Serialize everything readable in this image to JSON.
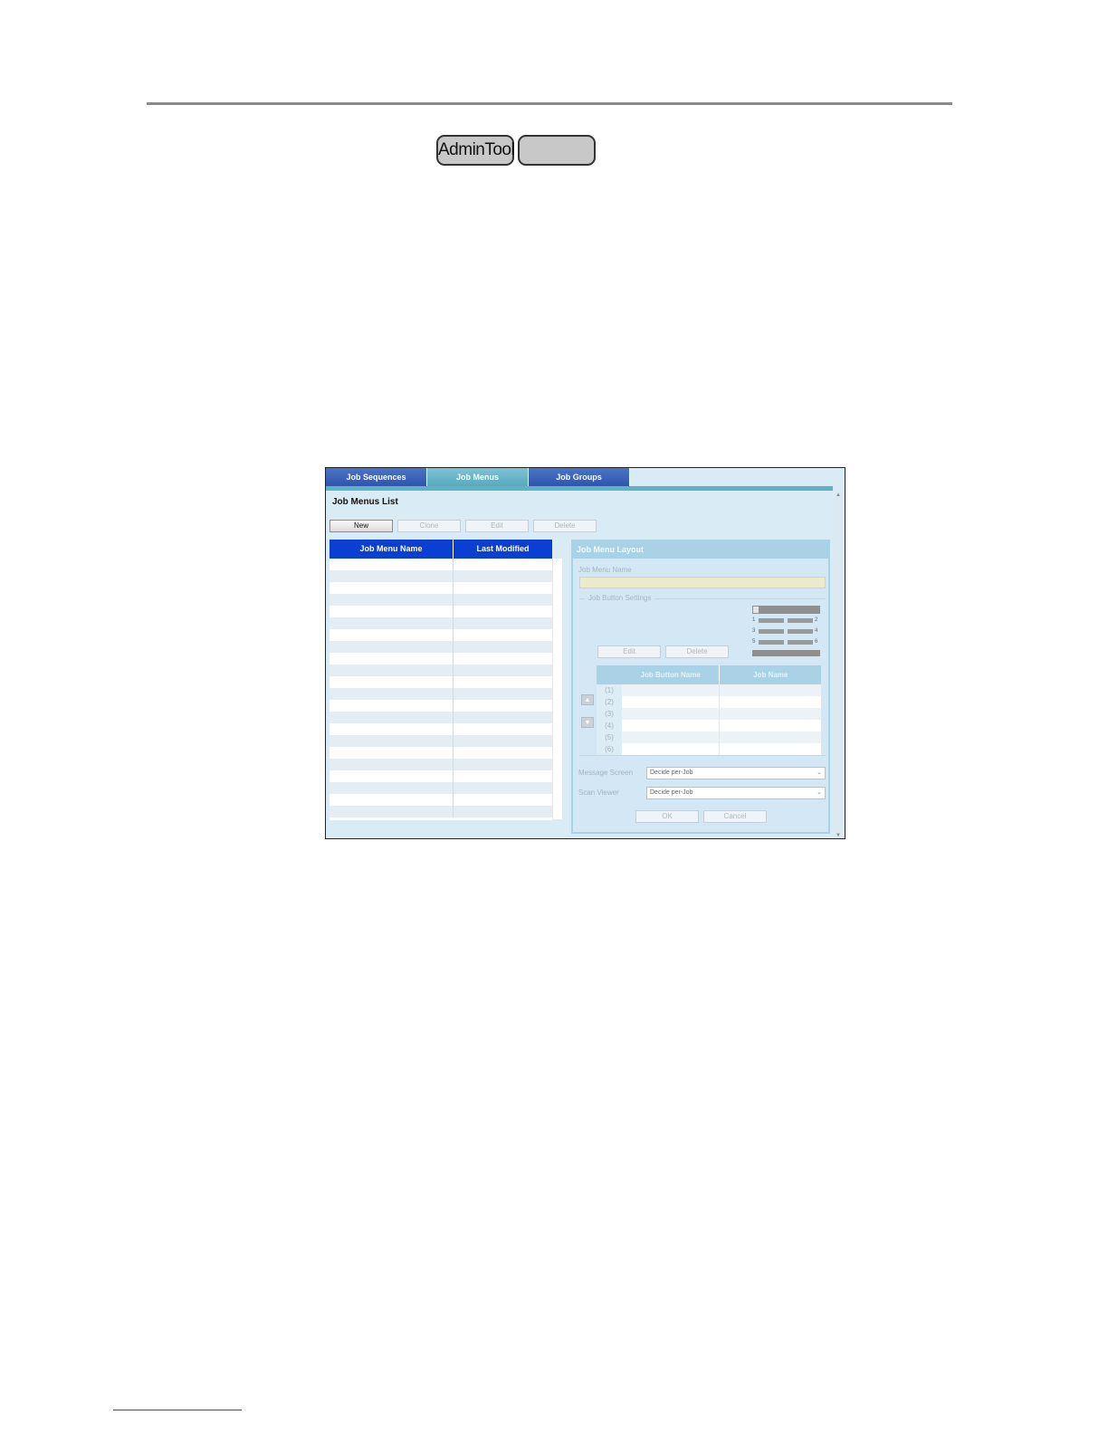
{
  "header": {
    "badges": [
      "AdminTool",
      ""
    ]
  },
  "app": {
    "tabs": [
      "Job Sequences",
      "Job Menus",
      "Job Groups"
    ],
    "active_tab": "Job Menus",
    "list_title": "Job Menus List",
    "toolbar": {
      "new_label": "New",
      "clone_label": "Clone",
      "edit_label": "Edit",
      "delete_label": "Delete"
    },
    "list_columns": [
      "Job Menu Name",
      "Last Modified"
    ],
    "layout": {
      "title": "Job Menu Layout",
      "job_menu_name_label": "Job Menu Name",
      "job_menu_name_value": "",
      "job_button_settings_label": "Job Button Settings",
      "device_numbers": [
        "1",
        "2",
        "3",
        "4",
        "5",
        "6"
      ],
      "edit_label": "Edit",
      "delete_label": "Delete",
      "table_columns": [
        "Job Button Name",
        "Job Name"
      ],
      "rows": [
        "(1)",
        "(2)",
        "(3)",
        "(4)",
        "(5)",
        "(6)"
      ],
      "message_screen_label": "Message Screen",
      "message_screen_value": "Decide per-Job",
      "scan_viewer_label": "Scan Viewer",
      "scan_viewer_value": "Decide per-Job",
      "ok_label": "OK",
      "cancel_label": "Cancel"
    }
  },
  "colors": {
    "tab_blue": "#2f55ab",
    "tab_active": "#5aa9bd",
    "list_header": "#0a3fd1",
    "panel_bg": "#d9ecf6"
  }
}
